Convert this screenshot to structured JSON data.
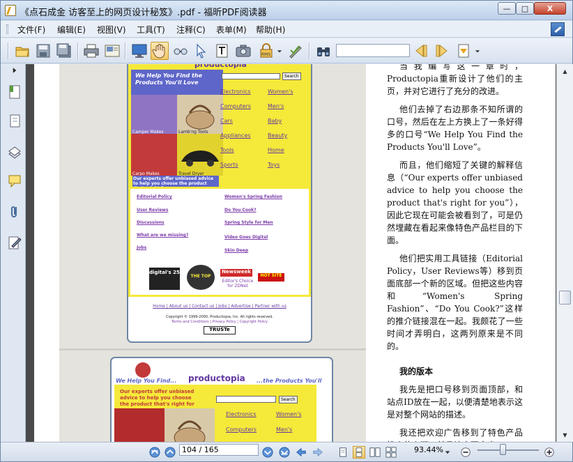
{
  "window": {
    "title": "《点石成金 访客至上的网页设计秘笈》.pdf - 福昕PDF阅读器",
    "min": "—",
    "max": "□",
    "close": "X"
  },
  "menu": [
    "文件(F)",
    "编辑(E)",
    "视图(V)",
    "工具(T)",
    "注释(C)",
    "表单(M)",
    "帮助(H)"
  ],
  "toolbar": {
    "search_value": ""
  },
  "scan1": {
    "logo": "productopia",
    "hero": "We Help You Find the Products You'll Love",
    "search": "Search",
    "captions": [
      "Camper Makes",
      "Lamb'ng Tools",
      "Carpo Makes",
      "Travel Dryer"
    ],
    "categories": [
      "Electronics",
      "Women's",
      "Computers",
      "Men's",
      "Cars",
      "Baby",
      "Appliances",
      "Beauty",
      "Tools",
      "Home",
      "Sports",
      "Toys"
    ],
    "tagline": "Our experts offer unbiased advice to help you choose the product that's right for you.",
    "features": [
      "Editorial Policy",
      "User Reviews",
      "Discussions",
      "What are we missing?",
      "Jobs",
      "Women's Spring Fashion",
      "Do You Cook?",
      "Spring Style for Men",
      "Video Goes Digital",
      "Skin Deep"
    ],
    "awards": [
      "digital's 25",
      "THE TOP",
      "Newsweek",
      "HOT SITE",
      "Editor's Choice for ZDNet"
    ],
    "footer_links": "Home | About us | Contact us | Jobs | Advertise | Partner with us",
    "copyright": "Copyright © 1999-2000, Productopia, Inc. All rights reserved.",
    "footer_small": "Terms and Conditions | Privacy Policy | Copyright Policy",
    "trust": "TRUSTe"
  },
  "scan2": {
    "header_left": "We Help You Find...",
    "logo": "productopia",
    "header_right": "...the Products You'll Love",
    "tagline": "Our experts offer unbiased advice to help you choose the product that's right for you.",
    "search": "Search",
    "categories": [
      "Electronics",
      "Women's",
      "Computers",
      "Men's"
    ]
  },
  "text": {
    "p1": "当我编写这一章时，Productopia重新设计了他们的主页，并对它进行了充分的改进。",
    "p2": "他们去掉了右边那条不知所谓的口号，然后在左上方换上了一条好得多的口号“We Help You Find the Products You'll Love”。",
    "p3": "而且，他们缩短了关键的解释信息（“Our experts offer unbiased advice to help you choose the product that's right for you”），因此它现在可能会被看到了，可是仍然埋藏在看起来像特色产品栏目的下面。",
    "p4": "他们把实用工具链接（Editorial Policy，User Reviews等）移到页面底部一个新的区域。但把这些内容和“Women's Spring Fashion”、“Do You Cook?”这样的推介链接混在一起。我颇花了一些时间才弄明白，这两列原来是不同的。",
    "h": "我的版本",
    "p5": "我先是把口号移到页面顶部，和站点ID放在一起，以便清楚地表示这是对整个网站的描述。",
    "p6": "我还把欢迎广告移到了特色产品推介的上面，并且让它更突出"
  },
  "status": {
    "page": "104 / 165",
    "zoom": "93.44%"
  },
  "colors": {
    "hero_blue": "#5e66c9",
    "site_yellow": "#f5e93a",
    "link_purple": "#6338a0"
  }
}
